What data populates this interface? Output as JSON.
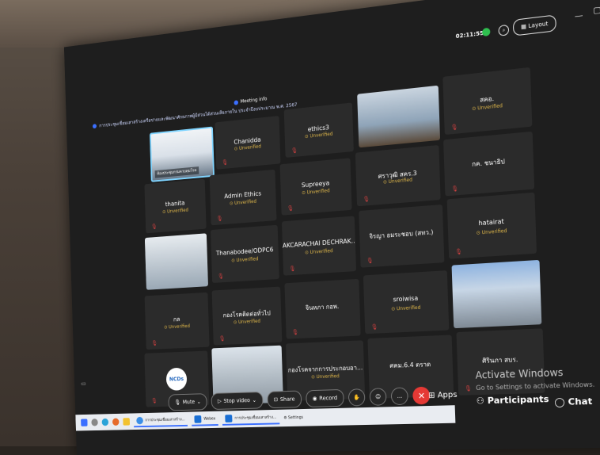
{
  "header": {
    "meeting_title": "การประชุมเชื่อมเสาสร้างเครือข่ายและพัฒนาศักยภาพผู้มีส่วนได้ส่วนเสียภายใน ประจำปีงบประมาณ พ.ศ. 2567",
    "meeting_info": "Meeting info",
    "timer": "02:11:55",
    "layout_label": "Layout",
    "window_min": "—",
    "window_max": "▢"
  },
  "tiles": [
    {
      "name": "",
      "caption": "ห้องประชุมกรมควบคุมโรค",
      "type": "video"
    },
    {
      "name": "Chanidda",
      "status": "Unverified"
    },
    {
      "name": "ethics3",
      "status": "Unverified"
    },
    {
      "name": "",
      "type": "video"
    },
    {
      "name": "สคอ.",
      "status": "Unverified"
    },
    {
      "name": "thanita",
      "status": "Unverified"
    },
    {
      "name": "Admin Ethics",
      "status": "Unverified"
    },
    {
      "name": "Supreeya",
      "status": "Unverified"
    },
    {
      "name": "ศราวุฒิ สคร.3",
      "status": "Unverified"
    },
    {
      "name": "กค. ชนาธิป",
      "status": ""
    },
    {
      "name": "",
      "type": "video"
    },
    {
      "name": "Thanabodee/ODPC6",
      "status": "Unverified"
    },
    {
      "name": "AKCARACHAI DECHRAK...",
      "status": "Unverified"
    },
    {
      "name": "จิรญา อมระชอบ (สทว.)",
      "status": ""
    },
    {
      "name": "hatairat",
      "status": "Unverified"
    },
    {
      "name": "กล",
      "status": "Unverified"
    },
    {
      "name": "กองโรคติดต่อทั่วไป",
      "status": "Unverified"
    },
    {
      "name": "จินหภา กอพ.",
      "status": ""
    },
    {
      "name": "sroiwisa",
      "status": "Unverified"
    },
    {
      "name": "",
      "type": "video"
    },
    {
      "name": "",
      "logo": "NCDs",
      "type": "logo"
    },
    {
      "name": "",
      "type": "video"
    },
    {
      "name": "กองโรคจากการประกอบอา...",
      "status": "Unverified"
    },
    {
      "name": "ศคม.6.4 ตราด",
      "status": ""
    },
    {
      "name": "ศิรินภา สบร.",
      "status": ""
    }
  ],
  "controls": {
    "mute": "Mute",
    "stop_video": "Stop video",
    "share": "Share",
    "record": "Record",
    "apps": "Apps",
    "participants": "Participants",
    "chat": "Chat"
  },
  "watermark": {
    "line1": "Activate Windows",
    "line2": "Go to Settings to activate Windows."
  },
  "taskbar": {
    "items": [
      "การประชุมเชื่อมเสาสร้าง...",
      "Webex",
      "การประชุมเชื่อมเสาสร้าง...",
      "Settings"
    ]
  },
  "colors": {
    "unverified": "#e0b84a",
    "end_call": "#e53935",
    "active_speaker": "#7fd4ff"
  }
}
